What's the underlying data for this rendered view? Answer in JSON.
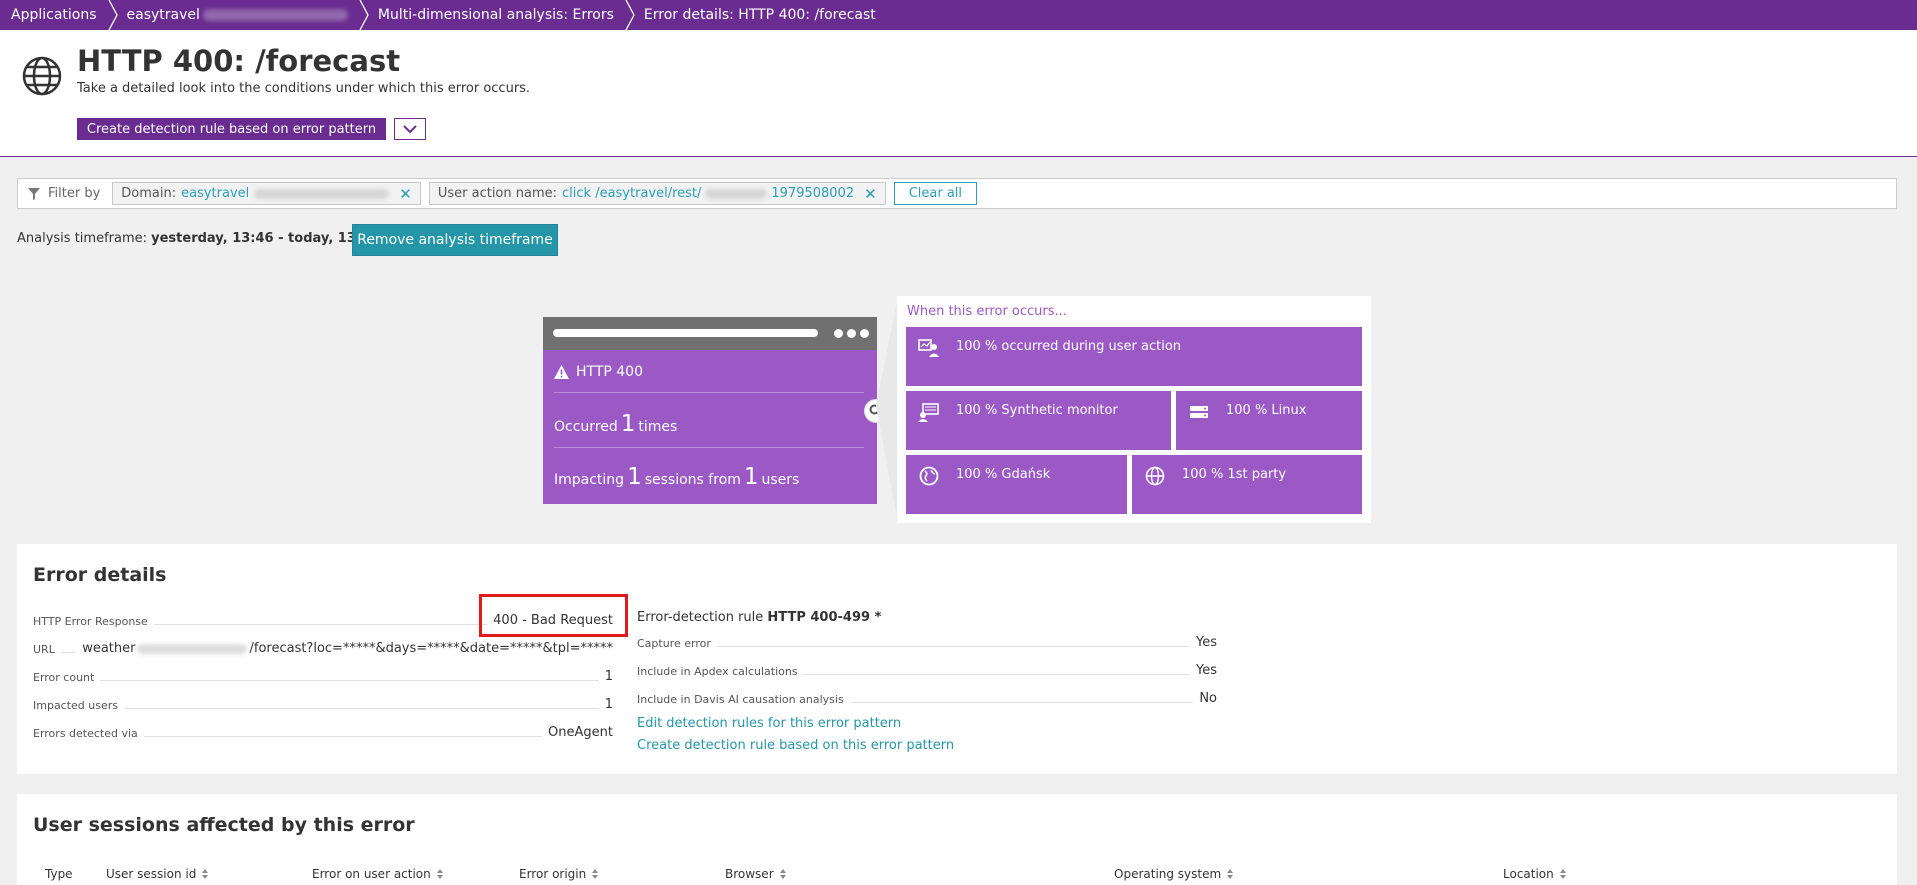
{
  "breadcrumb": [
    {
      "label": "Applications",
      "blurred": false
    },
    {
      "label": "easytravel",
      "blurred": true
    },
    {
      "label": "Multi-dimensional analysis: Errors",
      "blurred": false
    },
    {
      "label": "Error details: HTTP 400: /forecast",
      "blurred": false
    }
  ],
  "header": {
    "title": "HTTP 400: /forecast",
    "subtitle": "Take a detailed look into the conditions under which this error occurs.",
    "primary_button": "Create detection rule based on error pattern"
  },
  "filter": {
    "label": "Filter by",
    "chips": [
      {
        "key": "Domain:",
        "value": "easytravel",
        "suffix": ""
      },
      {
        "key": "User action name:",
        "value": "click /easytravel/rest/",
        "suffix": "1979508002"
      }
    ],
    "clear_label": "Clear all"
  },
  "timeframe": {
    "label": "Analysis timeframe:",
    "value": "yesterday, 13:46 - today, 13:46",
    "button": "Remove analysis timeframe"
  },
  "visual": {
    "error_name": "HTTP 400",
    "occurred_prefix": "Occurred",
    "occurred_count": "1",
    "occurred_suffix": "times",
    "impacting_prefix": "Impacting",
    "sessions_count": "1",
    "sessions_mid": "sessions from",
    "users_count": "1",
    "users_suffix": "users",
    "when_title": "When this error occurs...",
    "tiles": [
      {
        "label": "100 % occurred during user action",
        "icon": "user-action-icon"
      },
      {
        "label": "100 % Synthetic monitor",
        "icon": "synthetic-monitor-icon"
      },
      {
        "label": "100 % Linux",
        "icon": "server-icon"
      },
      {
        "label": "100 % Gdańsk",
        "icon": "location-globe-icon"
      },
      {
        "label": "100 % 1st party",
        "icon": "globe-icon"
      }
    ]
  },
  "error_details": {
    "title": "Error details",
    "rows": [
      {
        "label": "HTTP Error Response",
        "value": "400 - Bad Request"
      },
      {
        "label": "URL",
        "value_prefix": "weather",
        "value_suffix": "/forecast?loc=*****&days=*****&date=*****&tpl=*****"
      },
      {
        "label": "Error count",
        "value": "1"
      },
      {
        "label": "Impacted users",
        "value": "1"
      },
      {
        "label": "Errors detected via",
        "value": "OneAgent"
      }
    ],
    "rule_prefix": "Error-detection rule",
    "rule_name": "HTTP 400-499 *",
    "rule_rows": [
      {
        "label": "Capture error",
        "value": "Yes"
      },
      {
        "label": "Include in Apdex calculations",
        "value": "Yes"
      },
      {
        "label": "Include in Davis AI causation analysis",
        "value": "No"
      }
    ],
    "link_edit": "Edit detection rules for this error pattern",
    "link_create": "Create detection rule based on this error pattern"
  },
  "sessions": {
    "title": "User sessions affected by this error",
    "columns": [
      "Type",
      "User session id",
      "Error on user action",
      "Error origin",
      "Browser",
      "Operating system",
      "Location"
    ]
  },
  "colors": {
    "brand_purple": "#6a2c91",
    "tile_purple": "#9b59c6",
    "teal": "#2596a8",
    "highlight_red": "#e01b1b"
  }
}
